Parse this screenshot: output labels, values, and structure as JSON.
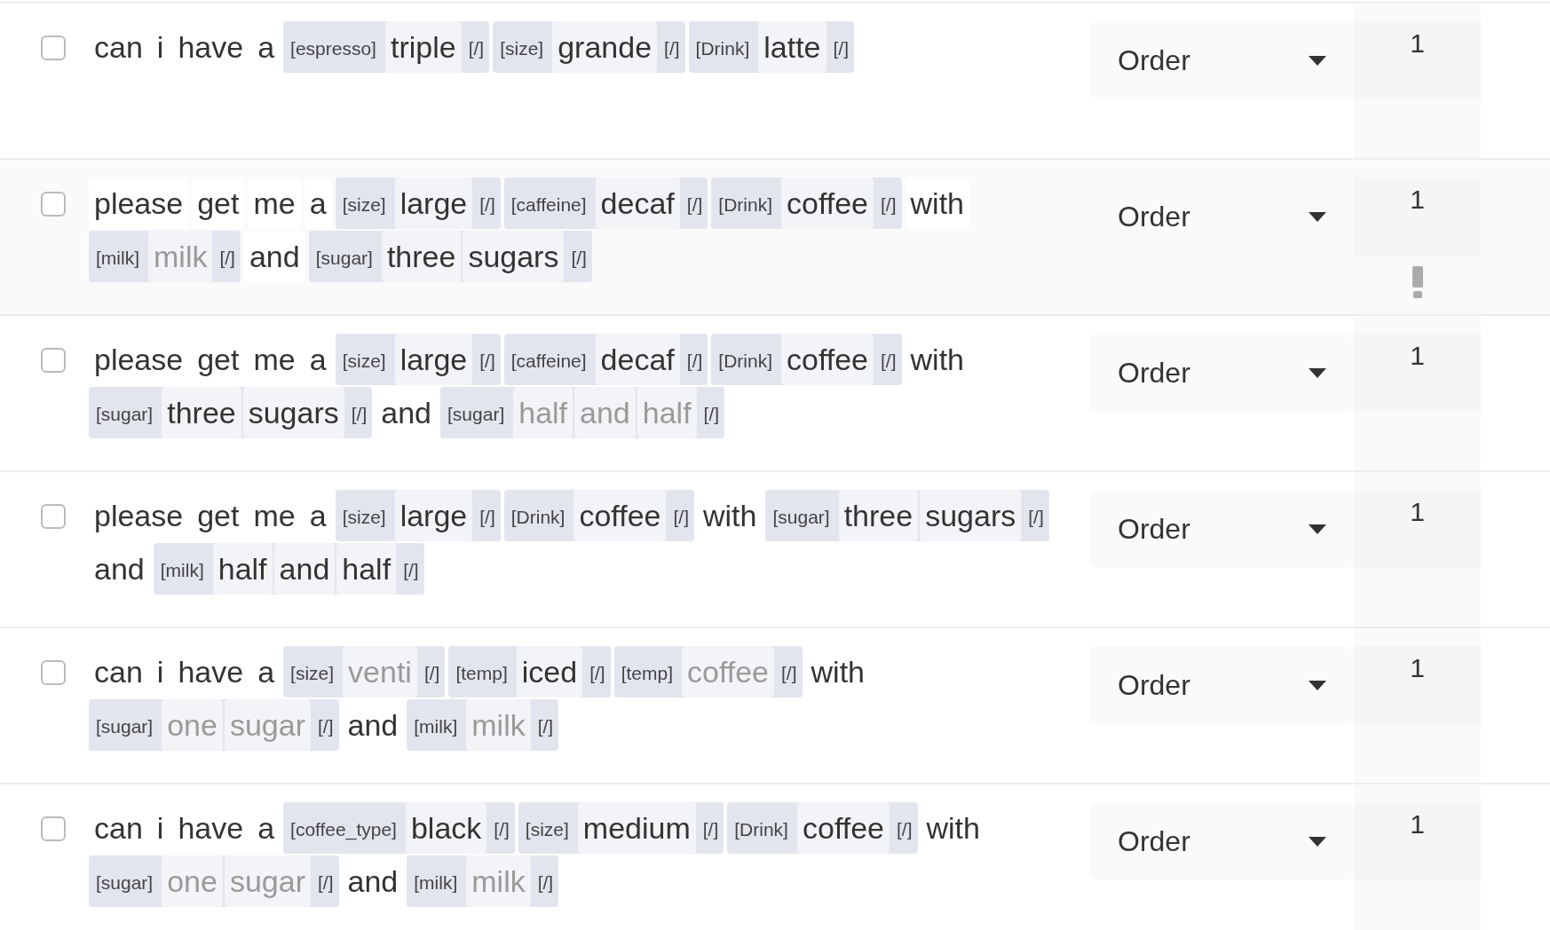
{
  "rows": [
    {
      "checked": false,
      "highlighted": false,
      "warning": false,
      "intent": "Order",
      "count": "1",
      "tokens": [
        {
          "kind": "word",
          "text": "can"
        },
        {
          "kind": "word",
          "text": "i"
        },
        {
          "kind": "word",
          "text": "have"
        },
        {
          "kind": "word",
          "text": "a"
        },
        {
          "kind": "entity",
          "label": "[espresso]",
          "words": [
            "triple"
          ],
          "end": "[/]",
          "faded": false
        },
        {
          "kind": "entity",
          "label": "[size]",
          "words": [
            "grande"
          ],
          "end": "[/]",
          "faded": false
        },
        {
          "kind": "entity",
          "label": "[Drink]",
          "words": [
            "latte"
          ],
          "end": "[/]",
          "faded": false
        }
      ]
    },
    {
      "checked": false,
      "highlighted": true,
      "warning": true,
      "intent": "Order",
      "count": "1",
      "tokens": [
        {
          "kind": "word",
          "text": "please"
        },
        {
          "kind": "word",
          "text": "get"
        },
        {
          "kind": "word",
          "text": "me"
        },
        {
          "kind": "word",
          "text": "a"
        },
        {
          "kind": "entity",
          "label": "[size]",
          "words": [
            "large"
          ],
          "end": "[/]",
          "faded": false
        },
        {
          "kind": "entity",
          "label": "[caffeine]",
          "words": [
            "decaf"
          ],
          "end": "[/]",
          "faded": false
        },
        {
          "kind": "entity",
          "label": "[Drink]",
          "words": [
            "coffee"
          ],
          "end": "[/]",
          "faded": false
        },
        {
          "kind": "word",
          "text": "with"
        },
        {
          "kind": "entity",
          "label": "[milk]",
          "words": [
            "milk"
          ],
          "end": "[/]",
          "faded": true
        },
        {
          "kind": "word",
          "text": "and"
        },
        {
          "kind": "entity",
          "label": "[sugar]",
          "words": [
            "three",
            "sugars"
          ],
          "end": "[/]",
          "faded": false
        }
      ]
    },
    {
      "checked": false,
      "highlighted": false,
      "warning": false,
      "intent": "Order",
      "count": "1",
      "tokens": [
        {
          "kind": "word",
          "text": "please"
        },
        {
          "kind": "word",
          "text": "get"
        },
        {
          "kind": "word",
          "text": "me"
        },
        {
          "kind": "word",
          "text": "a"
        },
        {
          "kind": "entity",
          "label": "[size]",
          "words": [
            "large"
          ],
          "end": "[/]",
          "faded": false
        },
        {
          "kind": "entity",
          "label": "[caffeine]",
          "words": [
            "decaf"
          ],
          "end": "[/]",
          "faded": false
        },
        {
          "kind": "entity",
          "label": "[Drink]",
          "words": [
            "coffee"
          ],
          "end": "[/]",
          "faded": false
        },
        {
          "kind": "word",
          "text": "with"
        },
        {
          "kind": "entity",
          "label": "[sugar]",
          "words": [
            "three",
            "sugars"
          ],
          "end": "[/]",
          "faded": false
        },
        {
          "kind": "word",
          "text": "and"
        },
        {
          "kind": "entity",
          "label": "[sugar]",
          "words": [
            "half",
            "and",
            "half"
          ],
          "end": "[/]",
          "faded": true
        }
      ]
    },
    {
      "checked": false,
      "highlighted": false,
      "warning": false,
      "intent": "Order",
      "count": "1",
      "tokens": [
        {
          "kind": "word",
          "text": "please"
        },
        {
          "kind": "word",
          "text": "get"
        },
        {
          "kind": "word",
          "text": "me"
        },
        {
          "kind": "word",
          "text": "a"
        },
        {
          "kind": "entity",
          "label": "[size]",
          "words": [
            "large"
          ],
          "end": "[/]",
          "faded": false
        },
        {
          "kind": "entity",
          "label": "[Drink]",
          "words": [
            "coffee"
          ],
          "end": "[/]",
          "faded": false
        },
        {
          "kind": "word",
          "text": "with"
        },
        {
          "kind": "entity",
          "label": "[sugar]",
          "words": [
            "three",
            "sugars"
          ],
          "end": "[/]",
          "faded": false
        },
        {
          "kind": "word",
          "text": "and"
        },
        {
          "kind": "entity",
          "label": "[milk]",
          "words": [
            "half",
            "and",
            "half"
          ],
          "end": "[/]",
          "faded": false
        }
      ]
    },
    {
      "checked": false,
      "highlighted": false,
      "warning": false,
      "intent": "Order",
      "count": "1",
      "tokens": [
        {
          "kind": "word",
          "text": "can"
        },
        {
          "kind": "word",
          "text": "i"
        },
        {
          "kind": "word",
          "text": "have"
        },
        {
          "kind": "word",
          "text": "a"
        },
        {
          "kind": "entity",
          "label": "[size]",
          "words": [
            "venti"
          ],
          "end": "[/]",
          "faded": true
        },
        {
          "kind": "entity",
          "label": "[temp]",
          "words": [
            "iced"
          ],
          "end": "[/]",
          "faded": false
        },
        {
          "kind": "entity",
          "label": "[temp]",
          "words": [
            "coffee"
          ],
          "end": "[/]",
          "faded": true
        },
        {
          "kind": "word",
          "text": "with"
        },
        {
          "kind": "entity",
          "label": "[sugar]",
          "words": [
            "one",
            "sugar"
          ],
          "end": "[/]",
          "faded": true
        },
        {
          "kind": "word",
          "text": "and"
        },
        {
          "kind": "entity",
          "label": "[milk]",
          "words": [
            "milk"
          ],
          "end": "[/]",
          "faded": true
        }
      ]
    },
    {
      "checked": false,
      "highlighted": false,
      "warning": false,
      "intent": "Order",
      "count": "1",
      "tokens": [
        {
          "kind": "word",
          "text": "can"
        },
        {
          "kind": "word",
          "text": "i"
        },
        {
          "kind": "word",
          "text": "have"
        },
        {
          "kind": "word",
          "text": "a"
        },
        {
          "kind": "entity",
          "label": "[coffee_type]",
          "words": [
            "black"
          ],
          "end": "[/]",
          "faded": false
        },
        {
          "kind": "entity",
          "label": "[size]",
          "words": [
            "medium"
          ],
          "end": "[/]",
          "faded": false
        },
        {
          "kind": "entity",
          "label": "[Drink]",
          "words": [
            "coffee"
          ],
          "end": "[/]",
          "faded": false
        },
        {
          "kind": "word",
          "text": "with"
        },
        {
          "kind": "entity",
          "label": "[sugar]",
          "words": [
            "one",
            "sugar"
          ],
          "end": "[/]",
          "faded": true
        },
        {
          "kind": "word",
          "text": "and"
        },
        {
          "kind": "entity",
          "label": "[milk]",
          "words": [
            "milk"
          ],
          "end": "[/]",
          "faded": true
        }
      ]
    }
  ]
}
